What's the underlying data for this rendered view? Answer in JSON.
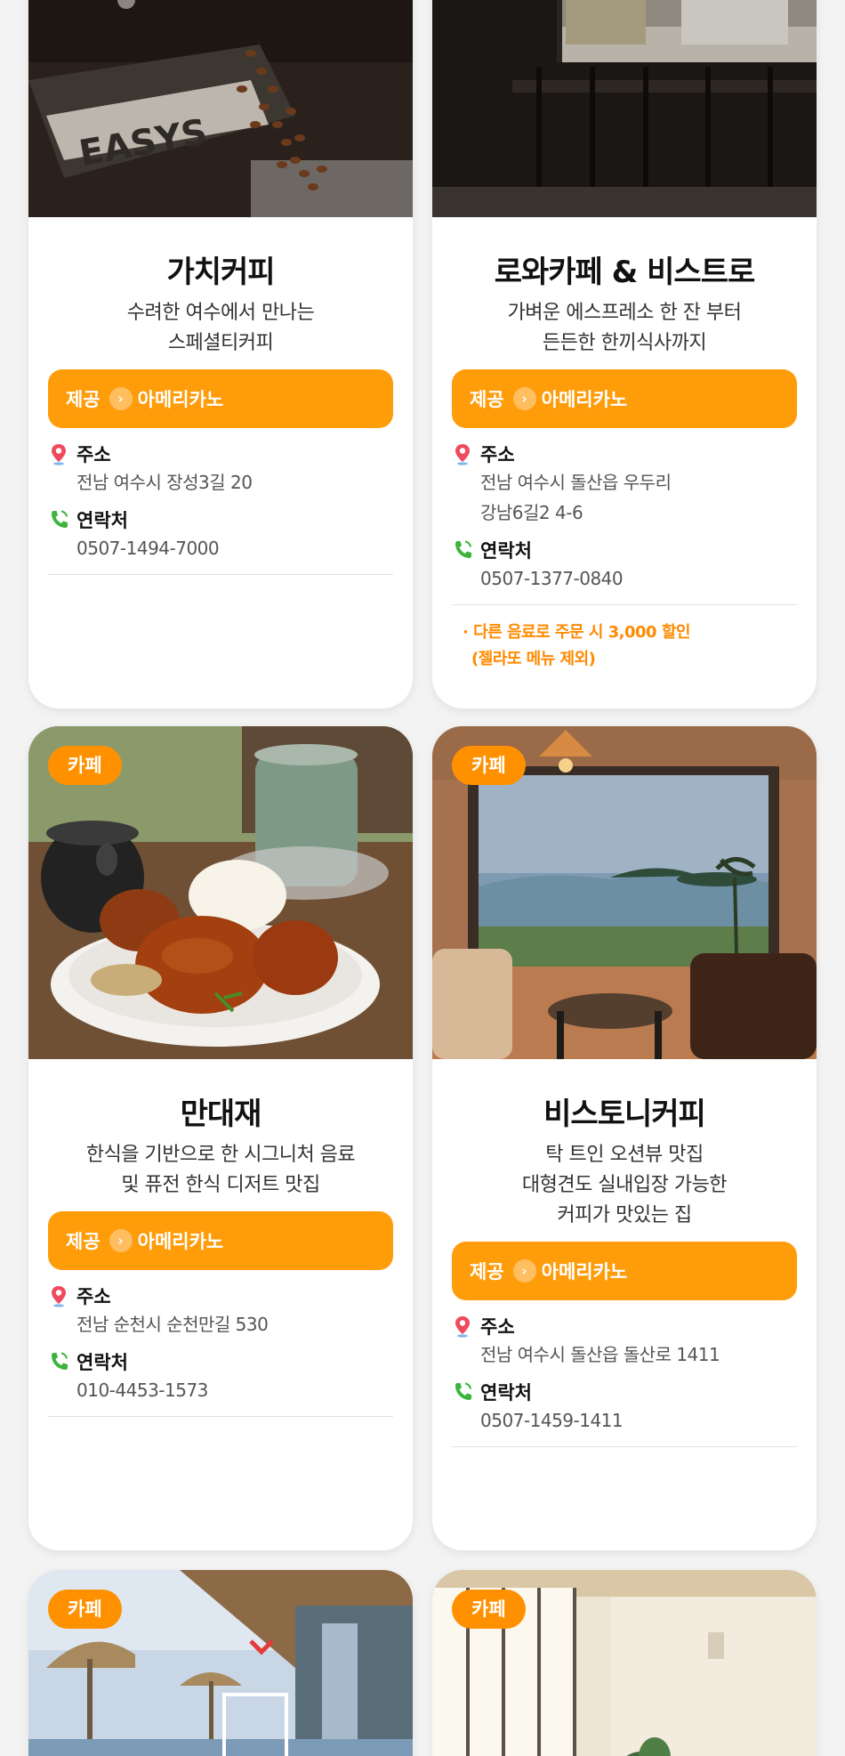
{
  "cards": [
    {
      "name": "가치커피",
      "desc_lines": [
        "수려한 여수에서 만나는",
        "스페셜티커피"
      ],
      "offer_prefix": "제공",
      "offer_item": "아메리카노",
      "address_label": "주소",
      "address_lines": [
        "전남 여수시 장성3길 20"
      ],
      "contact_label": "연락처",
      "contact": "0507-1494-7000"
    },
    {
      "name": "로와카페 & 비스트로",
      "desc_lines": [
        "가벼운 에스프레소 한 잔 부터",
        "든든한 한끼식사까지"
      ],
      "offer_prefix": "제공",
      "offer_item": "아메리카노",
      "address_label": "주소",
      "address_lines": [
        "전남 여수시 돌산읍 우두리",
        "강남6길2 4-6"
      ],
      "contact_label": "연락처",
      "contact": "0507-1377-0840",
      "note_lines": [
        "· 다른 음료로 주문 시 3,000 할인",
        "(젤라또 메뉴 제외)"
      ]
    },
    {
      "category": "카페",
      "name": "만대재",
      "desc_lines": [
        "한식을 기반으로 한 시그니처 음료",
        "및 퓨전 한식 디저트 맛집"
      ],
      "offer_prefix": "제공",
      "offer_item": "아메리카노",
      "address_label": "주소",
      "address_lines": [
        "전남 순천시 순천만길 530"
      ],
      "contact_label": "연락처",
      "contact": "010-4453-1573"
    },
    {
      "category": "카페",
      "name": "비스토니커피",
      "desc_lines": [
        "탁 트인 오션뷰 맛집",
        "대형견도 실내입장 가능한",
        "커피가 맛있는 집"
      ],
      "offer_prefix": "제공",
      "offer_item": "아메리카노",
      "address_label": "주소",
      "address_lines": [
        "전남 여수시 돌산읍 돌산로 1411"
      ],
      "contact_label": "연락처",
      "contact": "0507-1459-1411"
    },
    {
      "category": "카페"
    },
    {
      "category": "카페"
    }
  ],
  "colors": {
    "accent": "#ff9100",
    "note": "#ff8a00",
    "pin": "#ef4a5e",
    "phone": "#3cb43c"
  },
  "icons": {
    "address": "map-pin-icon",
    "contact": "phone-icon",
    "offer_arrow": "chevron-right-icon"
  }
}
